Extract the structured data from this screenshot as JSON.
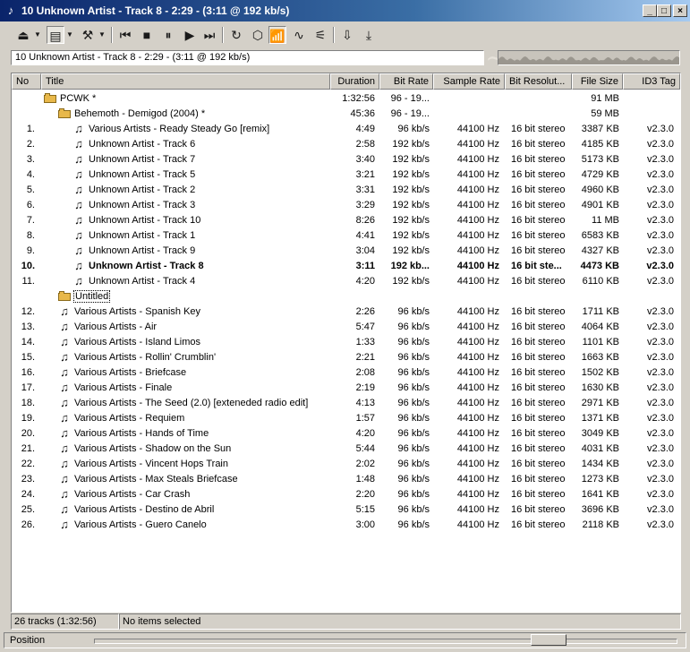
{
  "window": {
    "title": "10 Unknown Artist - Track 8 - 2:29 - (3:11 @ 192 kb/s)",
    "controls": {
      "minimize": "_",
      "maximize": "□",
      "close": "×"
    }
  },
  "toolbar": {
    "buttons": [
      {
        "name": "eject-icon",
        "glyph": "⏏"
      },
      {
        "name": "playlist-menu-icon",
        "glyph": "▤"
      },
      {
        "name": "tools-icon",
        "glyph": "⚒"
      },
      {
        "name": "previous-track-icon",
        "glyph": "⏮"
      },
      {
        "name": "stop-icon",
        "glyph": "■"
      },
      {
        "name": "pause-icon",
        "glyph": "⏸"
      },
      {
        "name": "play-icon",
        "glyph": "▶"
      },
      {
        "name": "next-track-icon",
        "glyph": "⏭"
      },
      {
        "name": "repeat-icon",
        "glyph": "↻"
      },
      {
        "name": "cube-icon",
        "glyph": "⬡"
      },
      {
        "name": "spectrum-icon",
        "glyph": "📶"
      },
      {
        "name": "waveform-icon",
        "glyph": "∿"
      },
      {
        "name": "mixer-icon",
        "glyph": "⚟"
      },
      {
        "name": "download-icon",
        "glyph": "⇩"
      },
      {
        "name": "download-to-tray-icon",
        "glyph": "⤓"
      }
    ]
  },
  "now_playing": "10 Unknown Artist - Track 8 - 2:29 - (3:11 @ 192 kb/s)",
  "columns": [
    {
      "label": "No",
      "align": "l"
    },
    {
      "label": "Title",
      "align": "l"
    },
    {
      "label": "Duration",
      "align": "r"
    },
    {
      "label": "Bit Rate",
      "align": "r"
    },
    {
      "label": "Sample Rate",
      "align": "r"
    },
    {
      "label": "Bit Resolut...",
      "align": "l"
    },
    {
      "label": "File Size",
      "align": "r"
    },
    {
      "label": "ID3 Tag",
      "align": "r"
    }
  ],
  "rows": [
    {
      "kind": "group",
      "depth": 0,
      "no": "",
      "title": "PCWK *",
      "duration": "1:32:56",
      "bitrate": "96 - 19...",
      "samplerate": "",
      "bitres": "",
      "filesize": "91 MB",
      "id3": ""
    },
    {
      "kind": "group",
      "depth": 1,
      "no": "",
      "title": "Behemoth - Demigod (2004) *",
      "duration": "45:36",
      "bitrate": "96 - 19...",
      "samplerate": "",
      "bitres": "",
      "filesize": "59 MB",
      "id3": ""
    },
    {
      "kind": "track",
      "depth": 2,
      "no": "1.",
      "title": "Various Artists - Ready Steady Go [remix]",
      "duration": "4:49",
      "bitrate": "96 kb/s",
      "samplerate": "44100 Hz",
      "bitres": "16 bit stereo",
      "filesize": "3387 KB",
      "id3": "v2.3.0"
    },
    {
      "kind": "track",
      "depth": 2,
      "no": "2.",
      "title": "Unknown Artist - Track 6",
      "duration": "2:58",
      "bitrate": "192 kb/s",
      "samplerate": "44100 Hz",
      "bitres": "16 bit stereo",
      "filesize": "4185 KB",
      "id3": "v2.3.0"
    },
    {
      "kind": "track",
      "depth": 2,
      "no": "3.",
      "title": "Unknown Artist - Track 7",
      "duration": "3:40",
      "bitrate": "192 kb/s",
      "samplerate": "44100 Hz",
      "bitres": "16 bit stereo",
      "filesize": "5173 KB",
      "id3": "v2.3.0"
    },
    {
      "kind": "track",
      "depth": 2,
      "no": "4.",
      "title": "Unknown Artist - Track 5",
      "duration": "3:21",
      "bitrate": "192 kb/s",
      "samplerate": "44100 Hz",
      "bitres": "16 bit stereo",
      "filesize": "4729 KB",
      "id3": "v2.3.0"
    },
    {
      "kind": "track",
      "depth": 2,
      "no": "5.",
      "title": "Unknown Artist - Track 2",
      "duration": "3:31",
      "bitrate": "192 kb/s",
      "samplerate": "44100 Hz",
      "bitres": "16 bit stereo",
      "filesize": "4960 KB",
      "id3": "v2.3.0"
    },
    {
      "kind": "track",
      "depth": 2,
      "no": "6.",
      "title": "Unknown Artist - Track 3",
      "duration": "3:29",
      "bitrate": "192 kb/s",
      "samplerate": "44100 Hz",
      "bitres": "16 bit stereo",
      "filesize": "4901 KB",
      "id3": "v2.3.0"
    },
    {
      "kind": "track",
      "depth": 2,
      "no": "7.",
      "title": "Unknown Artist - Track 10",
      "duration": "8:26",
      "bitrate": "192 kb/s",
      "samplerate": "44100 Hz",
      "bitres": "16 bit stereo",
      "filesize": "11 MB",
      "id3": "v2.3.0"
    },
    {
      "kind": "track",
      "depth": 2,
      "no": "8.",
      "title": "Unknown Artist - Track 1",
      "duration": "4:41",
      "bitrate": "192 kb/s",
      "samplerate": "44100 Hz",
      "bitres": "16 bit stereo",
      "filesize": "6583 KB",
      "id3": "v2.3.0"
    },
    {
      "kind": "track",
      "depth": 2,
      "no": "9.",
      "title": "Unknown Artist - Track 9",
      "duration": "3:04",
      "bitrate": "192 kb/s",
      "samplerate": "44100 Hz",
      "bitres": "16 bit stereo",
      "filesize": "4327 KB",
      "id3": "v2.3.0"
    },
    {
      "kind": "track",
      "depth": 2,
      "no": "10.",
      "title": "Unknown Artist - Track 8",
      "duration": "3:11",
      "bitrate": "192 kb...",
      "samplerate": "44100 Hz",
      "bitres": "16 bit ste...",
      "filesize": "4473 KB",
      "id3": "v2.3.0",
      "playing": true
    },
    {
      "kind": "track",
      "depth": 2,
      "no": "11.",
      "title": "Unknown Artist - Track 4",
      "duration": "4:20",
      "bitrate": "192 kb/s",
      "samplerate": "44100 Hz",
      "bitres": "16 bit stereo",
      "filesize": "6110 KB",
      "id3": "v2.3.0"
    },
    {
      "kind": "group",
      "depth": 1,
      "no": "",
      "title": "Untitled",
      "duration": "",
      "bitrate": "",
      "samplerate": "",
      "bitres": "",
      "filesize": "",
      "id3": "",
      "focused": true
    },
    {
      "kind": "track",
      "depth": 1,
      "no": "12.",
      "title": "Various Artists - Spanish Key",
      "duration": "2:26",
      "bitrate": "96 kb/s",
      "samplerate": "44100 Hz",
      "bitres": "16 bit stereo",
      "filesize": "1711 KB",
      "id3": "v2.3.0"
    },
    {
      "kind": "track",
      "depth": 1,
      "no": "13.",
      "title": "Various Artists - Air",
      "duration": "5:47",
      "bitrate": "96 kb/s",
      "samplerate": "44100 Hz",
      "bitres": "16 bit stereo",
      "filesize": "4064 KB",
      "id3": "v2.3.0"
    },
    {
      "kind": "track",
      "depth": 1,
      "no": "14.",
      "title": "Various Artists - Island Limos",
      "duration": "1:33",
      "bitrate": "96 kb/s",
      "samplerate": "44100 Hz",
      "bitres": "16 bit stereo",
      "filesize": "1101 KB",
      "id3": "v2.3.0"
    },
    {
      "kind": "track",
      "depth": 1,
      "no": "15.",
      "title": "Various Artists - Rollin' Crumblin'",
      "duration": "2:21",
      "bitrate": "96 kb/s",
      "samplerate": "44100 Hz",
      "bitres": "16 bit stereo",
      "filesize": "1663 KB",
      "id3": "v2.3.0"
    },
    {
      "kind": "track",
      "depth": 1,
      "no": "16.",
      "title": "Various Artists - Briefcase",
      "duration": "2:08",
      "bitrate": "96 kb/s",
      "samplerate": "44100 Hz",
      "bitres": "16 bit stereo",
      "filesize": "1502 KB",
      "id3": "v2.3.0"
    },
    {
      "kind": "track",
      "depth": 1,
      "no": "17.",
      "title": "Various Artists - Finale",
      "duration": "2:19",
      "bitrate": "96 kb/s",
      "samplerate": "44100 Hz",
      "bitres": "16 bit stereo",
      "filesize": "1630 KB",
      "id3": "v2.3.0"
    },
    {
      "kind": "track",
      "depth": 1,
      "no": "18.",
      "title": "Various Artists - The Seed (2.0) [exteneded radio edit]",
      "duration": "4:13",
      "bitrate": "96 kb/s",
      "samplerate": "44100 Hz",
      "bitres": "16 bit stereo",
      "filesize": "2971 KB",
      "id3": "v2.3.0"
    },
    {
      "kind": "track",
      "depth": 1,
      "no": "19.",
      "title": "Various Artists - Requiem",
      "duration": "1:57",
      "bitrate": "96 kb/s",
      "samplerate": "44100 Hz",
      "bitres": "16 bit stereo",
      "filesize": "1371 KB",
      "id3": "v2.3.0"
    },
    {
      "kind": "track",
      "depth": 1,
      "no": "20.",
      "title": "Various Artists - Hands of Time",
      "duration": "4:20",
      "bitrate": "96 kb/s",
      "samplerate": "44100 Hz",
      "bitres": "16 bit stereo",
      "filesize": "3049 KB",
      "id3": "v2.3.0"
    },
    {
      "kind": "track",
      "depth": 1,
      "no": "21.",
      "title": "Various Artists - Shadow on the Sun",
      "duration": "5:44",
      "bitrate": "96 kb/s",
      "samplerate": "44100 Hz",
      "bitres": "16 bit stereo",
      "filesize": "4031 KB",
      "id3": "v2.3.0"
    },
    {
      "kind": "track",
      "depth": 1,
      "no": "22.",
      "title": "Various Artists - Vincent Hops Train",
      "duration": "2:02",
      "bitrate": "96 kb/s",
      "samplerate": "44100 Hz",
      "bitres": "16 bit stereo",
      "filesize": "1434 KB",
      "id3": "v2.3.0"
    },
    {
      "kind": "track",
      "depth": 1,
      "no": "23.",
      "title": "Various Artists - Max Steals Briefcase",
      "duration": "1:48",
      "bitrate": "96 kb/s",
      "samplerate": "44100 Hz",
      "bitres": "16 bit stereo",
      "filesize": "1273 KB",
      "id3": "v2.3.0"
    },
    {
      "kind": "track",
      "depth": 1,
      "no": "24.",
      "title": "Various Artists - Car Crash",
      "duration": "2:20",
      "bitrate": "96 kb/s",
      "samplerate": "44100 Hz",
      "bitres": "16 bit stereo",
      "filesize": "1641 KB",
      "id3": "v2.3.0"
    },
    {
      "kind": "track",
      "depth": 1,
      "no": "25.",
      "title": "Various Artists - Destino de Abril",
      "duration": "5:15",
      "bitrate": "96 kb/s",
      "samplerate": "44100 Hz",
      "bitres": "16 bit stereo",
      "filesize": "3696 KB",
      "id3": "v2.3.0"
    },
    {
      "kind": "track",
      "depth": 1,
      "no": "26.",
      "title": "Various Artists - Guero Canelo",
      "duration": "3:00",
      "bitrate": "96 kb/s",
      "samplerate": "44100 Hz",
      "bitres": "16 bit stereo",
      "filesize": "2118 KB",
      "id3": "v2.3.0"
    }
  ],
  "status": {
    "tracks": "26 tracks (1:32:56)",
    "selection": "No items selected"
  },
  "position": {
    "label": "Position",
    "value": 0.8
  },
  "colors": {
    "titlebar_start": "#0a246a",
    "titlebar_end": "#a6caf0",
    "window_face": "#d4d0c8",
    "folder": "#e8b84a"
  }
}
